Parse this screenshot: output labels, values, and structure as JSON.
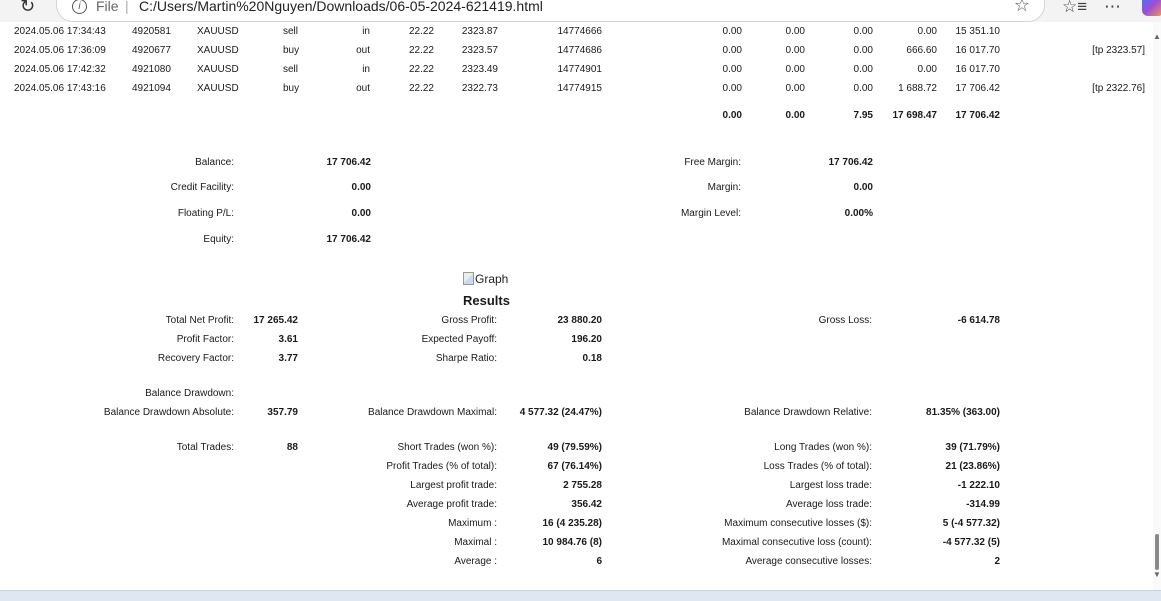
{
  "browser": {
    "file_label": "File",
    "url": "C:/Users/Martin%20Nguyen/Downloads/06-05-2024-621419.html"
  },
  "deals": [
    {
      "time": "2024.05.06 17:34:43",
      "deal": "4920581",
      "symbol": "XAUUSD",
      "type": "sell",
      "direction": "in",
      "volume": "22.22",
      "price": "2323.87",
      "order": "14774666",
      "commission": "0.00",
      "fee": "0.00",
      "swap": "0.00",
      "profit": "0.00",
      "balance": "15 351.10",
      "comment": ""
    },
    {
      "time": "2024.05.06 17:36:09",
      "deal": "4920677",
      "symbol": "XAUUSD",
      "type": "buy",
      "direction": "out",
      "volume": "22.22",
      "price": "2323.57",
      "order": "14774686",
      "commission": "0.00",
      "fee": "0.00",
      "swap": "0.00",
      "profit": "666.60",
      "balance": "16 017.70",
      "comment": "[tp 2323.57]"
    },
    {
      "time": "2024.05.06 17:42:32",
      "deal": "4921080",
      "symbol": "XAUUSD",
      "type": "sell",
      "direction": "in",
      "volume": "22.22",
      "price": "2323.49",
      "order": "14774901",
      "commission": "0.00",
      "fee": "0.00",
      "swap": "0.00",
      "profit": "0.00",
      "balance": "16 017.70",
      "comment": ""
    },
    {
      "time": "2024.05.06 17:43:16",
      "deal": "4921094",
      "symbol": "XAUUSD",
      "type": "buy",
      "direction": "out",
      "volume": "22.22",
      "price": "2322.73",
      "order": "14774915",
      "commission": "0.00",
      "fee": "0.00",
      "swap": "0.00",
      "profit": "1 688.72",
      "balance": "17 706.42",
      "comment": "[tp 2322.76]"
    }
  ],
  "totals": {
    "commission": "0.00",
    "fee": "0.00",
    "swap": "7.95",
    "profit": "17 698.47",
    "balance": "17 706.42"
  },
  "account": {
    "balance_label": "Balance:",
    "balance": "17 706.42",
    "credit_label": "Credit Facility:",
    "credit": "0.00",
    "floating_label": "Floating P/L:",
    "floating": "0.00",
    "equity_label": "Equity:",
    "equity": "17 706.42",
    "free_margin_label": "Free Margin:",
    "free_margin": "17 706.42",
    "margin_label": "Margin:",
    "margin": "0.00",
    "margin_level_label": "Margin Level:",
    "margin_level": "0.00%"
  },
  "graph_alt": "Graph",
  "results_title": "Results",
  "results": {
    "total_net_profit_label": "Total Net Profit:",
    "total_net_profit": "17 265.42",
    "profit_factor_label": "Profit Factor:",
    "profit_factor": "3.61",
    "recovery_factor_label": "Recovery Factor:",
    "recovery_factor": "3.77",
    "gross_profit_label": "Gross Profit:",
    "gross_profit": "23 880.20",
    "expected_payoff_label": "Expected Payoff:",
    "expected_payoff": "196.20",
    "sharpe_label": "Sharpe Ratio:",
    "sharpe": "0.18",
    "gross_loss_label": "Gross Loss:",
    "gross_loss": "-6 614.78",
    "balance_drawdown_label": "Balance Drawdown:",
    "bd_absolute_label": "Balance Drawdown Absolute:",
    "bd_absolute": "357.79",
    "bd_maximal_label": "Balance Drawdown Maximal:",
    "bd_maximal": "4 577.32 (24.47%)",
    "bd_relative_label": "Balance Drawdown Relative:",
    "bd_relative": "81.35% (363.00)",
    "total_trades_label": "Total Trades:",
    "total_trades": "88",
    "short_trades_label": "Short Trades (won %):",
    "short_trades": "49 (79.59%)",
    "profit_trades_label": "Profit Trades (% of total):",
    "profit_trades": "67 (76.14%)",
    "largest_profit_label": "Largest profit trade:",
    "largest_profit": "2 755.28",
    "avg_profit_label": "Average profit trade:",
    "avg_profit": "356.42",
    "maximum_label": "Maximum :",
    "maximum": "16 (4 235.28)",
    "maximal_label": "Maximal :",
    "maximal": "10 984.76 (8)",
    "average_label": "Average :",
    "average": "6",
    "long_trades_label": "Long Trades (won %):",
    "long_trades": "39 (71.79%)",
    "loss_trades_label": "Loss Trades (% of total):",
    "loss_trades": "21 (23.86%)",
    "largest_loss_label": "Largest loss trade:",
    "largest_loss": "-1 222.10",
    "avg_loss_label": "Average loss trade:",
    "avg_loss": "-314.99",
    "max_consec_losses_label": "Maximum consecutive losses ($):",
    "max_consec_losses": "5 (-4 577.32)",
    "maximal_consec_loss_label": "Maximal consecutive loss (count):",
    "maximal_consec_loss": "-4 577.32 (5)",
    "avg_consec_losses_label": "Average consecutive losses:",
    "avg_consec_losses": "2"
  }
}
